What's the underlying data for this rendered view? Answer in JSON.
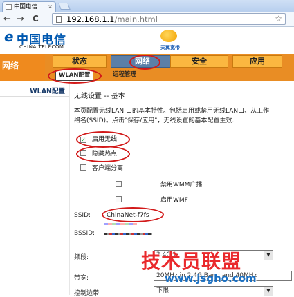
{
  "browser": {
    "tab_title": "中国电信",
    "tab_close": "×",
    "back_arrow": "←",
    "forward_arrow": "→",
    "reload": "C",
    "url_main": "192.168.1.1",
    "url_path": "/main.html",
    "star": "☆"
  },
  "brand": {
    "logo_symbol": "e",
    "logo_cn": "中国电信",
    "logo_en": "CHINA TELECOM",
    "tianyi_text": "天翼宽带"
  },
  "nav": {
    "section": "网络",
    "tabs": [
      "状态",
      "网络",
      "安全",
      "应用"
    ],
    "subtabs": [
      "WLAN配置",
      "远程管理"
    ]
  },
  "sidebar": {
    "items": [
      "WLAN配置"
    ]
  },
  "content": {
    "title": "无线设置 -- 基本",
    "desc_line1": "本页配置无线LAN 口的基本特性。包括启用或禁用无线LAN口、从工作",
    "desc_line2": "络名(SSID)。点击\"保存/应用\"，无线设置的基本配置生效.",
    "checkboxes": [
      {
        "label": "启用无线",
        "checked": true
      },
      {
        "label": "隐藏热点",
        "checked": false
      },
      {
        "label": "客户端分离",
        "checked": false
      },
      {
        "label": "禁用WMM广播",
        "checked": false
      },
      {
        "label": "启用WMF",
        "checked": false
      }
    ],
    "check_mark": "✓",
    "ssid_label": "SSID:",
    "ssid_value": "ChinaNet-f7fs",
    "bssid_label": "BSSID:",
    "band_label": "频段:",
    "band_value": "2.4GHz",
    "bandwidth_label": "带宽:",
    "bandwidth_value": "20MHz in 2.4G Band and 40MHz",
    "sideband_label": "控制边带:",
    "sideband_value": "下限"
  },
  "watermark": {
    "title": "技术员联盟",
    "url": "www.jsgho.com"
  },
  "colors": {
    "nav_orange": "#e98d24",
    "active_tab": "#5b7fa8",
    "annotation_red": "#d21919",
    "watermark_red": "#e9292c",
    "watermark_blue": "#1a6fc1"
  }
}
